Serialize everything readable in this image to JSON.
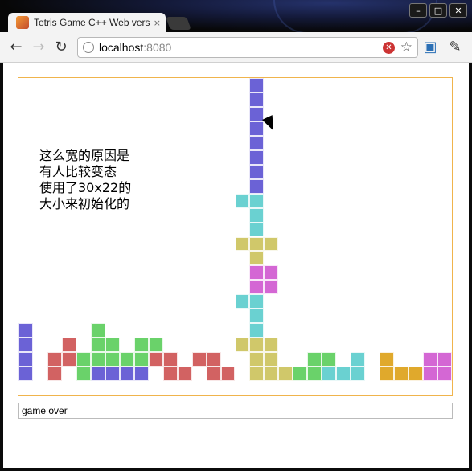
{
  "browser": {
    "tab_title": "Tetris Game C++ Web vers",
    "tab_close": "×",
    "url_host": "localhost",
    "url_port": ":8080",
    "window_min": "–",
    "window_max": "□",
    "window_close": "✕"
  },
  "game": {
    "note_text": "这么宽的原因是\n有人比较变态\n使用了30x22的\n大小来初始化的",
    "status_text": "game over",
    "colors": {
      "purple": "#6b62d6",
      "cyan": "#6ad1d1",
      "yellow": "#d0c86a",
      "magenta": "#d467d4",
      "red": "#d26262",
      "green": "#6ad26a",
      "gold": "#e0a92c"
    },
    "board_cols": 30,
    "board_rows": 22,
    "cells": [
      [
        16,
        0,
        "purple"
      ],
      [
        16,
        1,
        "purple"
      ],
      [
        16,
        2,
        "purple"
      ],
      [
        16,
        3,
        "purple"
      ],
      [
        16,
        4,
        "purple"
      ],
      [
        16,
        5,
        "purple"
      ],
      [
        16,
        6,
        "purple"
      ],
      [
        16,
        7,
        "purple"
      ],
      [
        15,
        8,
        "cyan"
      ],
      [
        16,
        8,
        "cyan"
      ],
      [
        16,
        9,
        "cyan"
      ],
      [
        16,
        10,
        "cyan"
      ],
      [
        15,
        11,
        "yellow"
      ],
      [
        16,
        11,
        "yellow"
      ],
      [
        17,
        11,
        "yellow"
      ],
      [
        16,
        12,
        "yellow"
      ],
      [
        16,
        13,
        "magenta"
      ],
      [
        17,
        13,
        "magenta"
      ],
      [
        16,
        14,
        "magenta"
      ],
      [
        17,
        14,
        "magenta"
      ],
      [
        15,
        15,
        "cyan"
      ],
      [
        16,
        15,
        "cyan"
      ],
      [
        16,
        16,
        "cyan"
      ],
      [
        16,
        17,
        "cyan"
      ],
      [
        0,
        17,
        "purple"
      ],
      [
        0,
        18,
        "purple"
      ],
      [
        0,
        19,
        "purple"
      ],
      [
        0,
        20,
        "purple"
      ],
      [
        5,
        17,
        "green"
      ],
      [
        3,
        18,
        "red"
      ],
      [
        5,
        18,
        "green"
      ],
      [
        6,
        18,
        "green"
      ],
      [
        8,
        18,
        "green"
      ],
      [
        9,
        18,
        "green"
      ],
      [
        2,
        19,
        "red"
      ],
      [
        3,
        19,
        "red"
      ],
      [
        4,
        19,
        "green"
      ],
      [
        5,
        19,
        "green"
      ],
      [
        6,
        19,
        "green"
      ],
      [
        7,
        19,
        "green"
      ],
      [
        8,
        19,
        "green"
      ],
      [
        9,
        19,
        "red"
      ],
      [
        10,
        19,
        "red"
      ],
      [
        12,
        19,
        "red"
      ],
      [
        13,
        19,
        "red"
      ],
      [
        2,
        20,
        "red"
      ],
      [
        4,
        20,
        "green"
      ],
      [
        5,
        20,
        "purple"
      ],
      [
        6,
        20,
        "purple"
      ],
      [
        7,
        20,
        "purple"
      ],
      [
        8,
        20,
        "purple"
      ],
      [
        10,
        20,
        "red"
      ],
      [
        11,
        20,
        "red"
      ],
      [
        13,
        20,
        "red"
      ],
      [
        14,
        20,
        "red"
      ],
      [
        15,
        18,
        "yellow"
      ],
      [
        16,
        18,
        "yellow"
      ],
      [
        17,
        18,
        "yellow"
      ],
      [
        16,
        19,
        "yellow"
      ],
      [
        17,
        19,
        "yellow"
      ],
      [
        16,
        20,
        "yellow"
      ],
      [
        17,
        20,
        "yellow"
      ],
      [
        18,
        20,
        "yellow"
      ],
      [
        20,
        19,
        "green"
      ],
      [
        21,
        19,
        "green"
      ],
      [
        19,
        20,
        "green"
      ],
      [
        20,
        20,
        "green"
      ],
      [
        21,
        20,
        "cyan"
      ],
      [
        22,
        20,
        "cyan"
      ],
      [
        23,
        19,
        "cyan"
      ],
      [
        23,
        20,
        "cyan"
      ],
      [
        25,
        19,
        "gold"
      ],
      [
        25,
        20,
        "gold"
      ],
      [
        26,
        20,
        "gold"
      ],
      [
        27,
        20,
        "gold"
      ],
      [
        28,
        19,
        "magenta"
      ],
      [
        29,
        19,
        "magenta"
      ],
      [
        28,
        20,
        "magenta"
      ],
      [
        29,
        20,
        "magenta"
      ]
    ]
  }
}
